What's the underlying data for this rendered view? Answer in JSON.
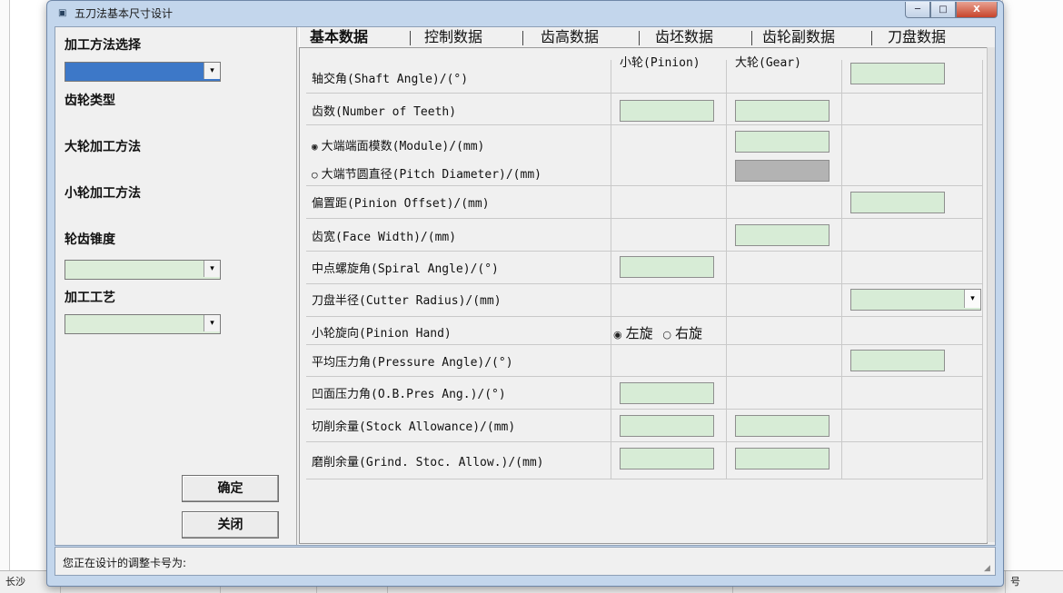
{
  "window": {
    "title": "五刀法基本尺寸设计",
    "title_icon": "app-icon",
    "controls": {
      "minimize": "─",
      "maximize": "□",
      "close": "X"
    }
  },
  "left_panel": {
    "method_label": "加工方法选择",
    "gear_type_label": "齿轮类型",
    "gear_process_label": "大轮加工方法",
    "pinion_process_label": "小轮加工方法",
    "taper_label": "轮齿锥度",
    "process_label": "加工工艺",
    "combo_arrow": "▾",
    "ok_button": "确定",
    "close_button": "关闭"
  },
  "tabs": [
    {
      "label": "基本数据",
      "active": true
    },
    {
      "label": "控制数据",
      "active": false
    },
    {
      "label": "齿高数据",
      "active": false
    },
    {
      "label": "齿坯数据",
      "active": false
    },
    {
      "label": "齿轮副数据",
      "active": false
    },
    {
      "label": "刀盘数据",
      "active": false
    }
  ],
  "columns": {
    "pinion": "小轮(Pinion)",
    "gear": "大轮(Gear)"
  },
  "rows": {
    "shaft_angle": "轴交角(Shaft Angle)/(°)",
    "teeth": "齿数(Number of Teeth)",
    "module": "大端端面模数(Module)/(mm)",
    "pitch_diameter": "大端节圆直径(Pitch Diameter)/(mm)",
    "offset": "偏置距(Pinion Offset)/(mm)",
    "face_width": "齿宽(Face Width)/(mm)",
    "spiral_angle": "中点螺旋角(Spiral Angle)/(°)",
    "cutter_radius": "刀盘半径(Cutter Radius)/(mm)",
    "pinion_hand": "小轮旋向(Pinion Hand)",
    "pressure_angle": "平均压力角(Pressure Angle)/(°)",
    "ob_pressure_angle": "凹面压力角(O.B.Pres Ang.)/(°)",
    "stock_allowance": "切削余量(Stock Allowance)/(mm)",
    "grind_allowance": "磨削余量(Grind. Stoc. Allow.)/(mm)"
  },
  "radios": {
    "selected": "◉",
    "unselected": "○"
  },
  "hand": {
    "left": "左旋",
    "right": "右旋",
    "selected": "left"
  },
  "status": {
    "text": "您正在设计的调整卡号为:"
  },
  "background": {
    "taskbar_cells": [
      "长沙",
      "",
      "",
      "",
      "",
      "",
      "号"
    ]
  },
  "colors": {
    "field_green": "#d7ecd6",
    "disabled_gray": "#b3b3b3",
    "selection_blue": "#3d78c8",
    "window_frame": "#c3d6ec"
  }
}
